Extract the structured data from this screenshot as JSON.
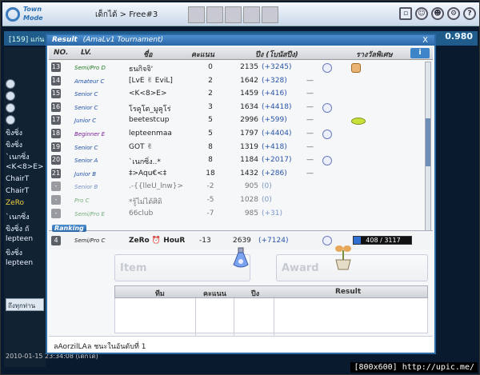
{
  "topbar": {
    "logo_line1": "Town",
    "logo_line2": "Mode",
    "room_tab": "เด็กได้ > Free#3"
  },
  "lobby": {
    "room_info": "[159] แก่น",
    "money": "0.980",
    "left_list": [
      {
        "text": "",
        "highlight": false
      },
      {
        "text": "",
        "highlight": false
      },
      {
        "text": "",
        "highlight": false
      },
      {
        "text": "",
        "highlight": false
      },
      {
        "text": "ขิงซิ่ง",
        "highlight": false
      },
      {
        "text": "ขิงซิ่ง",
        "highlight": false
      },
      {
        "text": "`เนกซิ่ง",
        "highlight": false
      },
      {
        "text": "<K<8>E>",
        "highlight": false
      },
      {
        "text": "ChairT",
        "highlight": false
      },
      {
        "text": "ChairT",
        "highlight": false
      },
      {
        "text": "ZeRo",
        "highlight": true
      },
      {
        "text": "`เนกซิ่ง",
        "highlight": false
      },
      {
        "text": "ขิงซิ่ง ถั",
        "highlight": false
      },
      {
        "text": "lepteen",
        "highlight": false
      },
      {
        "text": "ขิงซิ่ง",
        "highlight": false
      },
      {
        "text": "lepteen",
        "highlight": false
      }
    ],
    "chat_input": "ถึงทุกท่าน",
    "datestamp": "2010-01-15 23:34:08 (เด็กได้)",
    "watermark": "[800x600] http://upic.me/"
  },
  "dialog": {
    "title_prefix": "Result",
    "title": "(AmaLv1 Tournament)",
    "close": "X",
    "info_button": "i",
    "headers": {
      "no": "NO.",
      "lv": "LV.",
      "name": "ชื่อ",
      "score": "คะแนน",
      "exp": "ปีง (โบนัสปีง)",
      "reward": "รางวัลพิเศษ"
    },
    "rows": [
      {
        "rank": "13",
        "lv": "Semi/Pro D",
        "name": "ธนกิจจิ'",
        "score": "0",
        "exp": "2135",
        "gain": "(+3245)",
        "dash": "",
        "medal": true,
        "reward": "bag"
      },
      {
        "rank": "14",
        "lv": "Amateur C",
        "name": "[LvE ✌ EviL]",
        "score": "2",
        "exp": "1642",
        "gain": "(+328)",
        "dash": "—",
        "medal": false,
        "reward": ""
      },
      {
        "rank": "15",
        "lv": "Senior C",
        "name": "<K<8>E>",
        "score": "2",
        "exp": "1459",
        "gain": "(+416)",
        "dash": "—",
        "medal": false,
        "reward": ""
      },
      {
        "rank": "16",
        "lv": "Senior C",
        "name": "โรคูโต_มูคูโร่",
        "score": "3",
        "exp": "1634",
        "gain": "(+4418)",
        "dash": "—",
        "medal": true,
        "reward": ""
      },
      {
        "rank": "17",
        "lv": "Junior C",
        "name": "beetestcup",
        "score": "5",
        "exp": "2996",
        "gain": "(+599)",
        "dash": "—",
        "medal": false,
        "reward": "lime"
      },
      {
        "rank": "18",
        "lv": "Beginner E",
        "name": "lepteenmaa",
        "score": "5",
        "exp": "1797",
        "gain": "(+4404)",
        "dash": "—",
        "medal": true,
        "reward": ""
      },
      {
        "rank": "19",
        "lv": "Senior C",
        "name": "GOT ✌",
        "score": "8",
        "exp": "1319",
        "gain": "(+418)",
        "dash": "—",
        "medal": false,
        "reward": ""
      },
      {
        "rank": "20",
        "lv": "Senior A",
        "name": "`เนกซิ่ง..*",
        "score": "8",
        "exp": "1184",
        "gain": "(+2017)",
        "dash": "—",
        "medal": true,
        "reward": ""
      },
      {
        "rank": "21",
        "lv": "Junior B",
        "name": "‡>Aqu€<‡",
        "score": "18",
        "exp": "1432",
        "gain": "(+286)",
        "dash": "—",
        "medal": false,
        "reward": ""
      },
      {
        "rank": "-",
        "lv": "Senior B",
        "name": ".-{{lleU_lnw}>",
        "score": "-2",
        "exp": "905",
        "gain": "(0)",
        "dash": "",
        "medal": false,
        "reward": "",
        "faded": true
      },
      {
        "rank": "-",
        "lv": "Pro C",
        "name": "*รู้ไม่ได้ศิดิ",
        "score": "-5",
        "exp": "1028",
        "gain": "(0)",
        "dash": "",
        "medal": false,
        "reward": "",
        "faded": true
      },
      {
        "rank": "-",
        "lv": "Semi/Pro E",
        "name": "66club",
        "score": "-7",
        "exp": "985",
        "gain": "(+31)",
        "dash": "",
        "medal": false,
        "reward": "",
        "faded": true
      }
    ],
    "ranking_tag": "Ranking",
    "my": {
      "rank": "4",
      "lv": "Semi/Pro C",
      "name": "ZeRo ⏰ HouR",
      "score": "-13",
      "exp": "2639",
      "gain": "(+7124)",
      "bar_text": "408 / 3117",
      "bar_fraction": 0.131
    },
    "item_label": "Item",
    "award_label": "Award",
    "team_headers": {
      "team": "ทีม",
      "score": "คะแนน",
      "exp": "ปีง",
      "result": "Result"
    },
    "footer": "ลAorzilLAล ชนะในอันดับที่ 1"
  }
}
